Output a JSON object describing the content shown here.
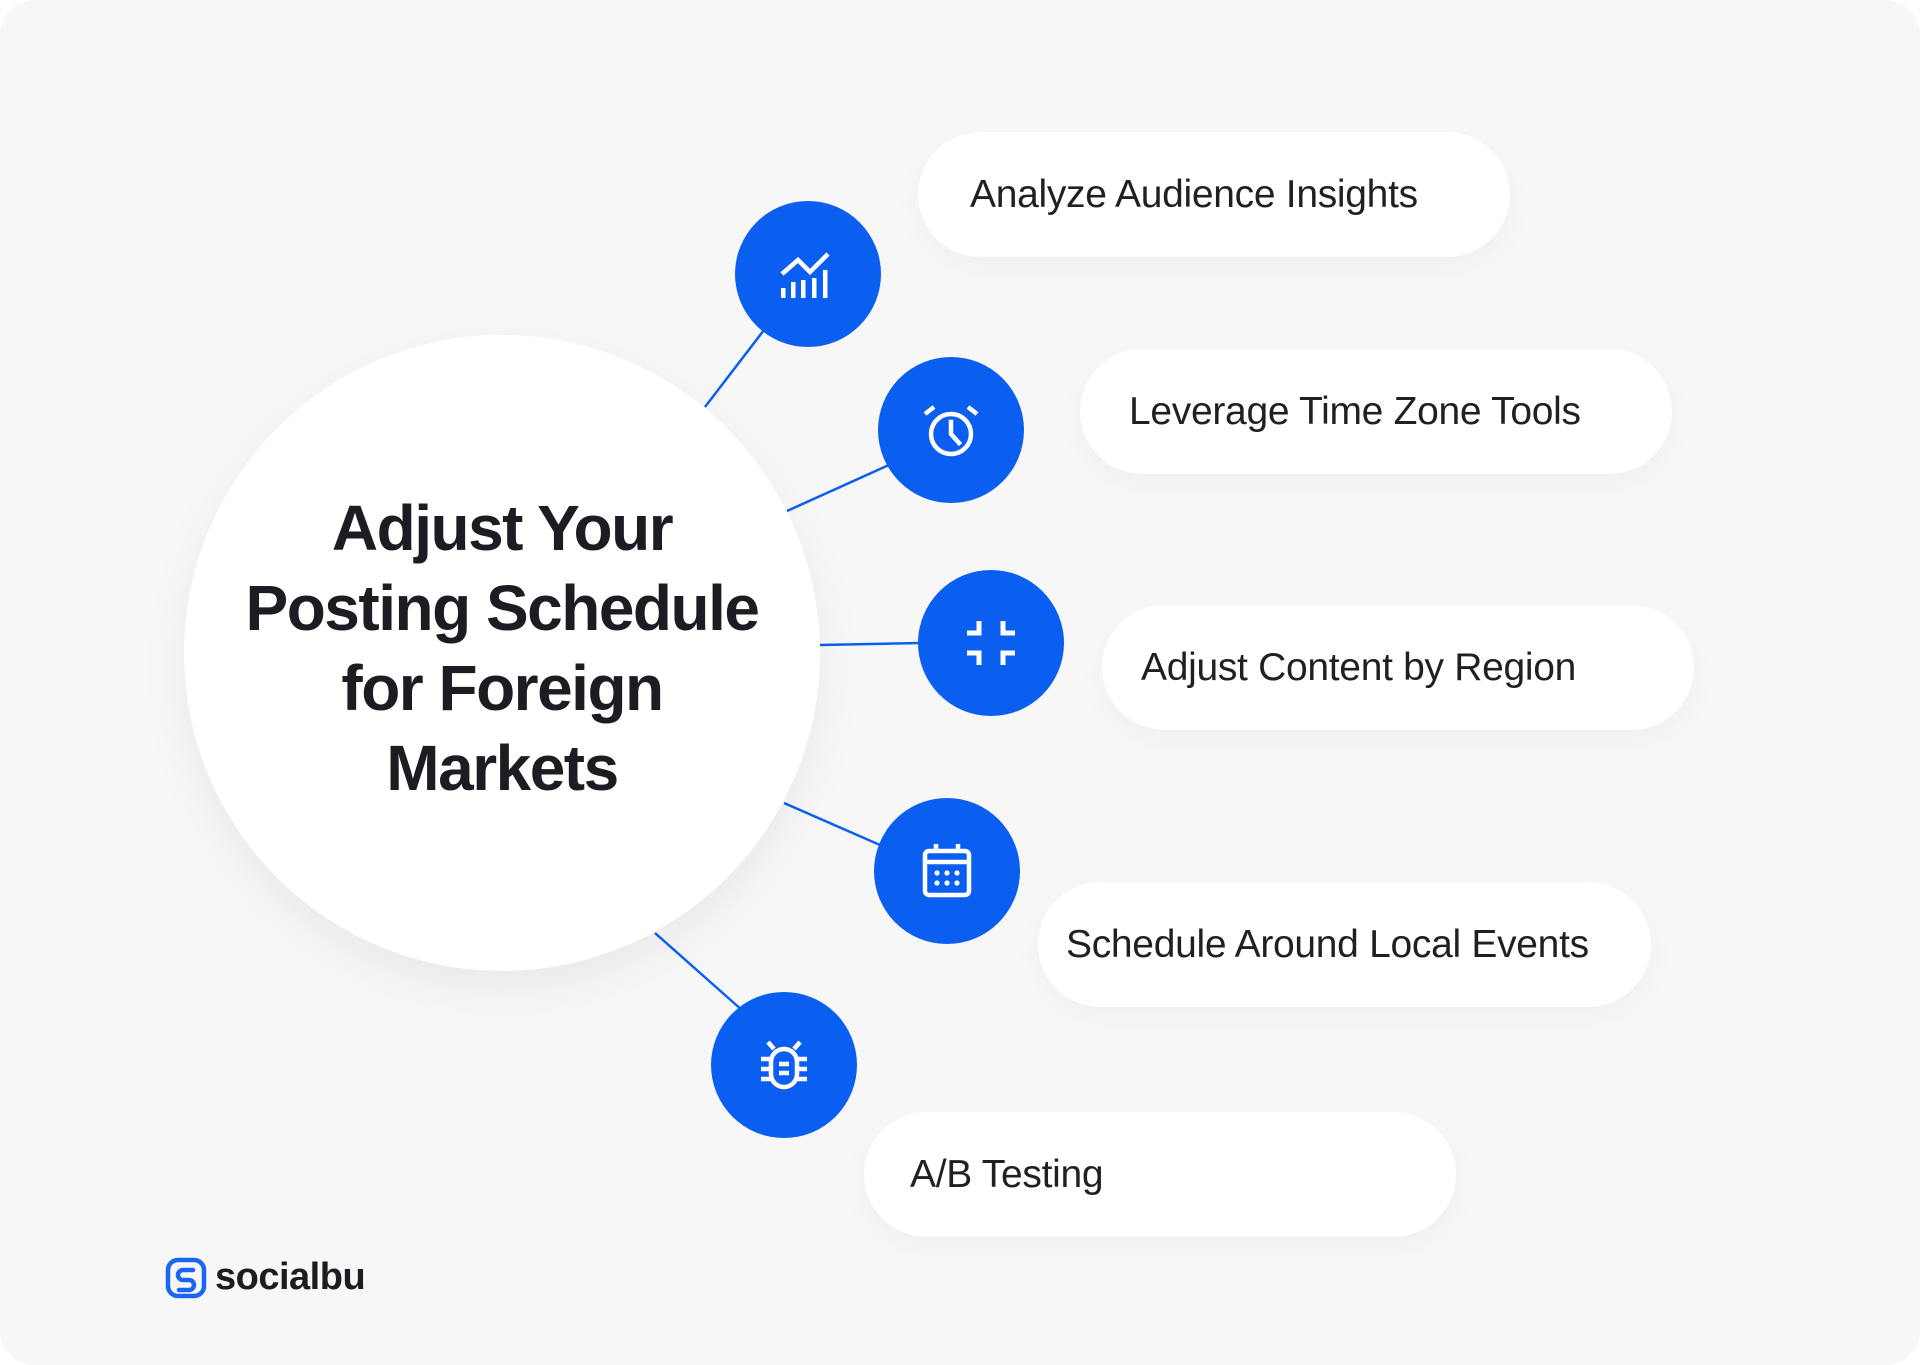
{
  "title": "Adjust Your Posting Schedule for Foreign Markets",
  "title_lines": [
    "Adjust Your",
    "Posting Schedule",
    "for Foreign",
    "Markets"
  ],
  "colors": {
    "accent": "#0a5ff0",
    "background": "#f7f7f8",
    "card": "#ffffff",
    "text": "#1c1d22"
  },
  "items": [
    {
      "label": "Analyze Audience Insights",
      "icon": "chart-growth-icon"
    },
    {
      "label": "Leverage Time Zone Tools",
      "icon": "alarm-clock-icon"
    },
    {
      "label": "Adjust Content by Region",
      "icon": "collapse-arrows-icon"
    },
    {
      "label": "Schedule Around Local Events",
      "icon": "calendar-icon"
    },
    {
      "label": "A/B Testing",
      "icon": "bug-icon"
    }
  ],
  "brand": {
    "name": "socialbu",
    "icon": "socialbu-logo-icon"
  }
}
